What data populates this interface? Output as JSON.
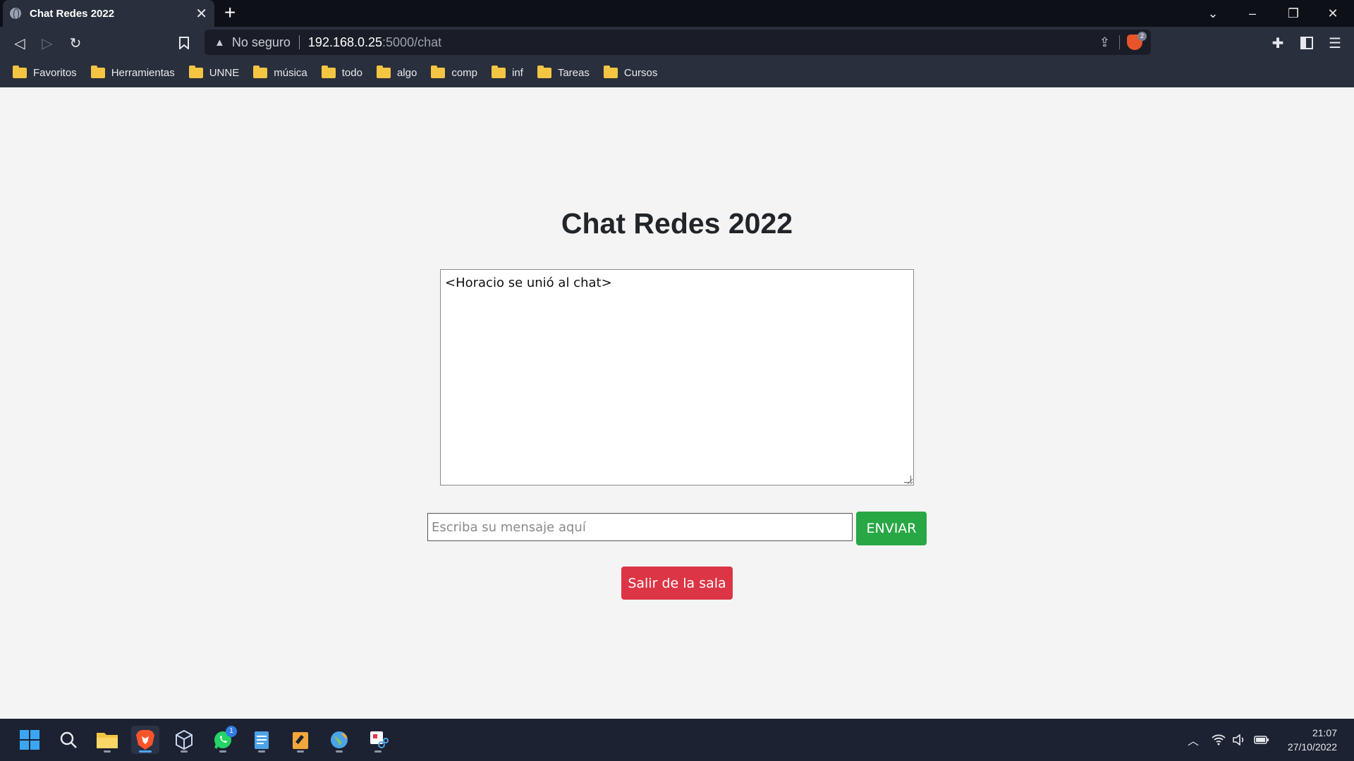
{
  "browser": {
    "tab": {
      "title": "Chat Redes 2022"
    },
    "new_tab_label": "+",
    "window_controls": {
      "dropdown": "⌄",
      "minimize": "–",
      "restore": "❐",
      "close": "✕"
    },
    "address": {
      "security_label": "No seguro",
      "host": "192.168.0.25",
      "path": ":5000/chat"
    },
    "shield_count": "2",
    "bookmarks": [
      {
        "label": "Favoritos"
      },
      {
        "label": "Herramientas"
      },
      {
        "label": "UNNE"
      },
      {
        "label": "música"
      },
      {
        "label": "todo"
      },
      {
        "label": "algo"
      },
      {
        "label": "comp"
      },
      {
        "label": "inf"
      },
      {
        "label": "Tareas"
      },
      {
        "label": "Cursos"
      }
    ]
  },
  "page": {
    "title": "Chat Redes 2022",
    "chat_log": "<Horacio se unió al chat>",
    "message_input": {
      "value": "",
      "placeholder": "Escriba su mensaje aquí"
    },
    "send_button": "ENVIAR",
    "leave_button": "Salir de la sala"
  },
  "taskbar": {
    "whatsapp_badge": "1",
    "time": "21:07",
    "date": "27/10/2022"
  },
  "colors": {
    "send": "#28a745",
    "leave": "#dc3545",
    "page_bg": "#f4f4f4",
    "browser_chrome": "#2a2f3d"
  }
}
